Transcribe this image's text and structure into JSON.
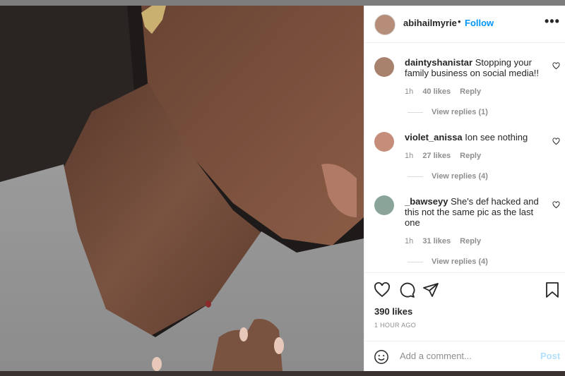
{
  "post": {
    "author": "abihailmyrie",
    "separator": "•",
    "follow_label": "Follow",
    "more_label": "•••",
    "photo_alt": "Close-up photo of a person's neck",
    "likes": "390 likes",
    "time_ago": "1 HOUR AGO",
    "comment_placeholder": "Add a comment...",
    "post_label": "Post"
  },
  "comments": [
    {
      "user": "daintyshanistar",
      "text": "Stopping your family business on social media!!",
      "time": "1h",
      "likes": "40 likes",
      "reply": "Reply",
      "view_replies": "View replies (1)"
    },
    {
      "user": "violet_anissa",
      "text": "Ion see nothing",
      "time": "1h",
      "likes": "27 likes",
      "reply": "Reply",
      "view_replies": "View replies (4)"
    },
    {
      "user": "_bawseyy",
      "text": "She's def hacked and this not the same pic as the last one",
      "time": "1h",
      "likes": "31 likes",
      "reply": "Reply",
      "view_replies": "View replies (4)"
    }
  ],
  "colors": {
    "accent": "#0095f6",
    "post_disabled": "#b2dffc",
    "text": "#262626",
    "muted": "#8e8e8e"
  }
}
